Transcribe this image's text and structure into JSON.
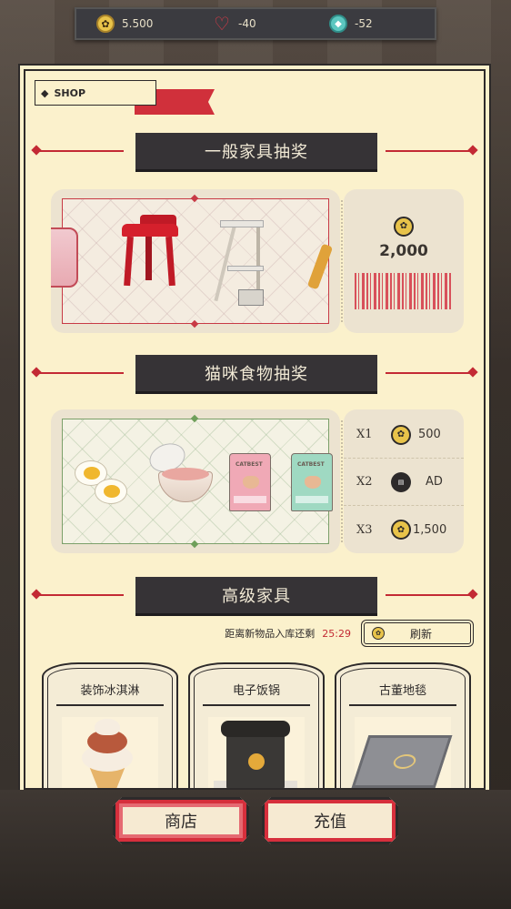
{
  "currency": {
    "coins": "5.500",
    "hearts": "-40",
    "gems": "-52"
  },
  "shop": {
    "tag": "SHOP"
  },
  "sections": {
    "furniture_lottery": "一般家具抽奖",
    "food_lottery": "猫咪食物抽奖",
    "premium": "高级家具"
  },
  "furniture_lottery": {
    "price": "2,000"
  },
  "food_lottery": {
    "options": [
      {
        "mult": "X1",
        "value": "500",
        "icon": "paw-coin-icon"
      },
      {
        "mult": "X2",
        "value": "AD",
        "icon": "ad-icon"
      },
      {
        "mult": "X3",
        "value": "1,500",
        "icon": "paw-coin-icon"
      }
    ],
    "bag_label": "CATBEST"
  },
  "restock": {
    "text": "距离新物品入库还剩",
    "time": "25:29",
    "refresh_label": "刷新"
  },
  "goods": [
    {
      "name": "装饰冰淇淋"
    },
    {
      "name": "电子饭锅"
    },
    {
      "name": "古董地毯"
    }
  ],
  "bottom_nav": {
    "shop": "商店",
    "recharge": "充值"
  },
  "colors": {
    "panel_bg": "#fbf1cc",
    "accent_red": "#c32a34",
    "plate_dark": "#363336",
    "coin_gold": "#e8c34a"
  }
}
